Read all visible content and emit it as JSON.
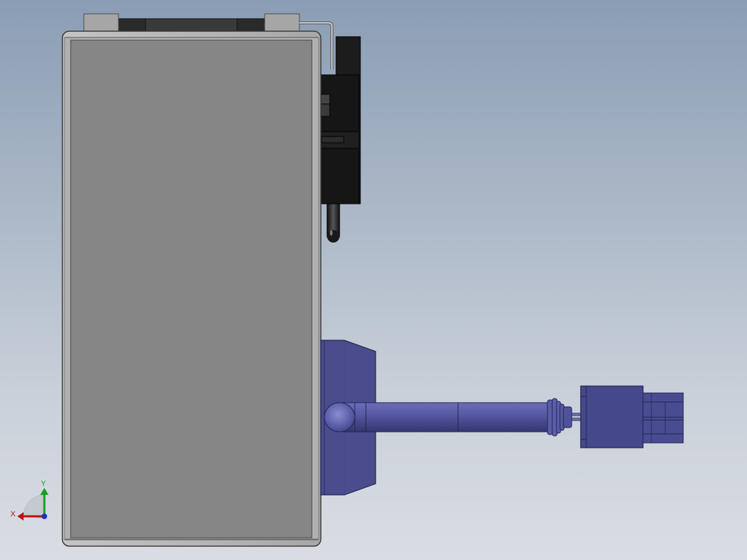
{
  "triad": {
    "x_label": "X",
    "y_label": "Y"
  },
  "colors": {
    "background_top": "#8a9db4",
    "background_bottom": "#d9dde3",
    "housing_face": "#868686",
    "housing_frame": "#b8b8b8",
    "bracket_black": "#1c1c1c",
    "cable_blue": "#494b8f",
    "axis_x": "#c01010",
    "axis_y": "#10a020",
    "axis_z": "#2030c0"
  }
}
